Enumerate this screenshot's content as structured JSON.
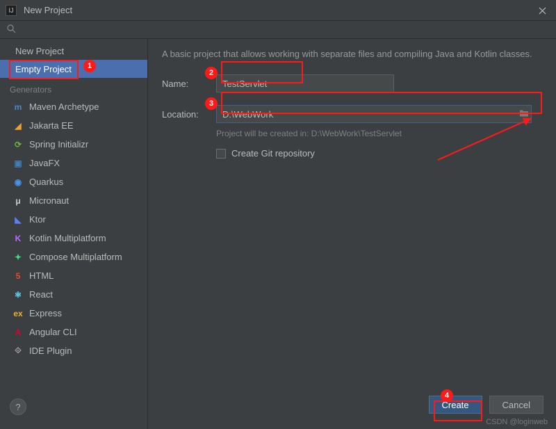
{
  "title": "New Project",
  "sidebar": {
    "new_project": "New Project",
    "empty_project": "Empty Project",
    "generators_header": "Generators",
    "generators": [
      {
        "label": "Maven Archetype",
        "icon": "m",
        "color": "#4a88c7"
      },
      {
        "label": "Jakarta EE",
        "icon": "◢",
        "color": "#f0a030"
      },
      {
        "label": "Spring Initializr",
        "icon": "⟳",
        "color": "#6db33f"
      },
      {
        "label": "JavaFX",
        "icon": "▣",
        "color": "#3e7eb9"
      },
      {
        "label": "Quarkus",
        "icon": "◉",
        "color": "#4695eb"
      },
      {
        "label": "Micronaut",
        "icon": "μ",
        "color": "#cccccc"
      },
      {
        "label": "Ktor",
        "icon": "◣",
        "color": "#5b7ff0"
      },
      {
        "label": "Kotlin Multiplatform",
        "icon": "K",
        "color": "#b66dff"
      },
      {
        "label": "Compose Multiplatform",
        "icon": "✦",
        "color": "#3ddc84"
      },
      {
        "label": "HTML",
        "icon": "5",
        "color": "#e44d26"
      },
      {
        "label": "React",
        "icon": "⚛",
        "color": "#61dafb"
      },
      {
        "label": "Express",
        "icon": "ex",
        "color": "#f0b030"
      },
      {
        "label": "Angular CLI",
        "icon": "A",
        "color": "#dd0031"
      },
      {
        "label": "IDE Plugin",
        "icon": "⟐",
        "color": "#aaaaaa"
      }
    ]
  },
  "content": {
    "description": "A basic project that allows working with separate files and compiling Java and Kotlin classes.",
    "name_label": "Name:",
    "name_value": "TestServlet",
    "location_label": "Location:",
    "location_value": "D:\\WebWork",
    "hint": "Project will be created in: D:\\WebWork\\TestServlet",
    "git_label": "Create Git repository"
  },
  "buttons": {
    "create": "Create",
    "cancel": "Cancel"
  },
  "watermark": "CSDN @loginweb",
  "annotations": {
    "b1": "1",
    "b2": "2",
    "b3": "3",
    "b4": "4"
  }
}
